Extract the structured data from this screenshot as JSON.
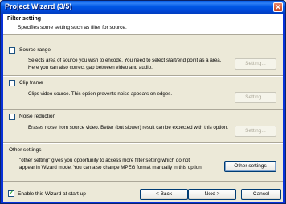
{
  "window": {
    "title": "Project Wizard (3/5)",
    "close_glyph": "✕"
  },
  "header": {
    "title": "Filter setting",
    "subtitle": "Specifies some setting such as filter for source."
  },
  "options": [
    {
      "label": "Source range",
      "checked": false,
      "desc_line1": "Selects area of source you wish to encode. You need to select start/end point as a area.",
      "desc_line2": "Here you can also correct gap between video and audio.",
      "button": "Setting..."
    },
    {
      "label": "Clip frame",
      "checked": false,
      "desc_line1": "Clips video source. This option prevents noise appears on edges.",
      "button": "Setting..."
    },
    {
      "label": "Noise reduction",
      "checked": false,
      "desc_line1": "Erases noise from source video. Better (but slower) result can be expected with this option.",
      "button": "Setting..."
    }
  ],
  "other": {
    "label": "Other settings",
    "desc_line1": "\"other setting\" gives you opportunity to access more filter setting which do not",
    "desc_line2": "appear in Wizard mode. You can also change MPEG format manually in this option.",
    "button": "Other settings"
  },
  "footer": {
    "enable_label": "Enable this Wizard at start up",
    "enable_checked": true,
    "back": "< Back",
    "next": "Next >",
    "cancel": "Cancel"
  }
}
